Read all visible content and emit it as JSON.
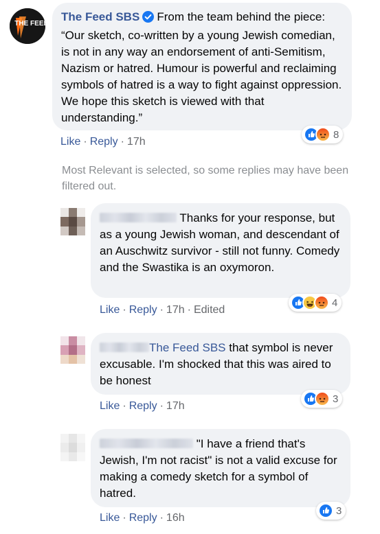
{
  "main_comment": {
    "author": "The Feed SBS",
    "avatar_text": "THE FEED",
    "text": "From the team behind the piece: “Our sketch, co-written by a young Jewish comedian, is not in any way an endorsement of anti-Semitism, Nazism or hatred. Humour is powerful and reclaiming symbols of hatred is a way to fight against oppression. We hope this sketch is viewed with that understanding.”",
    "reaction_count": "8",
    "reactions": [
      "like",
      "angry"
    ],
    "actions": {
      "like": "Like",
      "reply": "Reply",
      "time": "17h"
    }
  },
  "notice": "Most Relevant is selected, so some replies may have been filtered out.",
  "replies": [
    {
      "author": "",
      "text": "Thanks for your response, but as a young Jewish woman, and descendant of an Auschwitz survivor - still not funny. Comedy and the Swastika is an oxymoron.",
      "reaction_count": "4",
      "reactions": [
        "like",
        "haha",
        "angry"
      ],
      "actions": {
        "like": "Like",
        "reply": "Reply",
        "time": "17h",
        "edited": "Edited"
      }
    },
    {
      "author": "",
      "mention": "The Feed SBS",
      "text": "that symbol is never excusable. I'm shocked that this was aired to be honest",
      "reaction_count": "3",
      "reactions": [
        "like",
        "angry"
      ],
      "actions": {
        "like": "Like",
        "reply": "Reply",
        "time": "17h"
      }
    },
    {
      "author": "",
      "text": "\"I have a friend that's Jewish, I'm not racist\" is not a valid excuse for making a comedy sketch for a symbol of hatred.",
      "reaction_count": "3",
      "reactions": [
        "like"
      ],
      "actions": {
        "like": "Like",
        "reply": "Reply",
        "time": "16h"
      }
    }
  ],
  "colors": {
    "link": "#385898",
    "bubble": "#f0f2f5",
    "muted": "#65676b",
    "like_blue": "#1877f2",
    "angry_top": "#f26b1f",
    "haha_yellow": "#f7c844"
  },
  "separator": "·"
}
